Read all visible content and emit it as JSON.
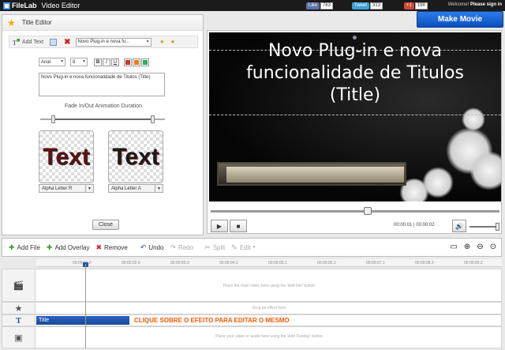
{
  "topbar": {
    "logo": "FileLab",
    "app_name": "Video Editor",
    "like_label": "Like",
    "like_count": "763",
    "tweet_label": "Tweet",
    "tweet_count": "313",
    "plusone_label": "+1",
    "plusone_count": "198",
    "welcome": "Welcome!",
    "sign_in": "Please sign in"
  },
  "make_movie": "Make Movie",
  "editor": {
    "title": "Title Editor",
    "add_text": "Add Text",
    "preset_value": "Novo Plug-in e nova fu...",
    "font_value": "Arial",
    "size_value": "8",
    "bold": "B",
    "italic": "I",
    "underline": "U",
    "text_value": "Novo Plug-in e nova funcionalidade de Titulos (Title)",
    "fade_label": "Fade In/Out Animation Duration",
    "fade_in": 0.1,
    "fade_out": 0.9,
    "thumb_text": "Text",
    "thumb1_select": "Alpha Letter R",
    "thumb2_select": "Alpha Letter A",
    "close": "Close"
  },
  "preview": {
    "title_line1": "Novo Plug-in e nova",
    "title_line2": "funcionalidade de Titulos",
    "title_line3": "(Title)",
    "current_time": "00:00:01",
    "duration": "00:00:02",
    "time_separator": "|"
  },
  "timeline": {
    "add_file": "Add File",
    "add_overlay": "Add Overlay",
    "remove": "Remove",
    "undo": "Undo",
    "redo": "Redo",
    "split": "Split",
    "edit": "Edit",
    "ruler_ticks": [
      "00:00:01.0",
      "00:00:02.0",
      "00:00:03.0",
      "00:00:04.1",
      "00:00:05.1",
      "00:00:06.1",
      "00:00:07.1",
      "00:00:08.2",
      "00:00:09.2"
    ],
    "video_hint": "Place the main video here using the 'Add File' button",
    "effect_hint": "Drop an effect here",
    "overlay_hint": "Place your video or audio here using the 'Add Overlay' button",
    "title_clip": "Title",
    "annotation": "CLIQUE SOBRE O EFEITO PARA EDITAR O MESMO"
  },
  "colors": {
    "accent": "#0a4fbf",
    "annotation": "#f25c00",
    "clip": "#2b63bf"
  }
}
